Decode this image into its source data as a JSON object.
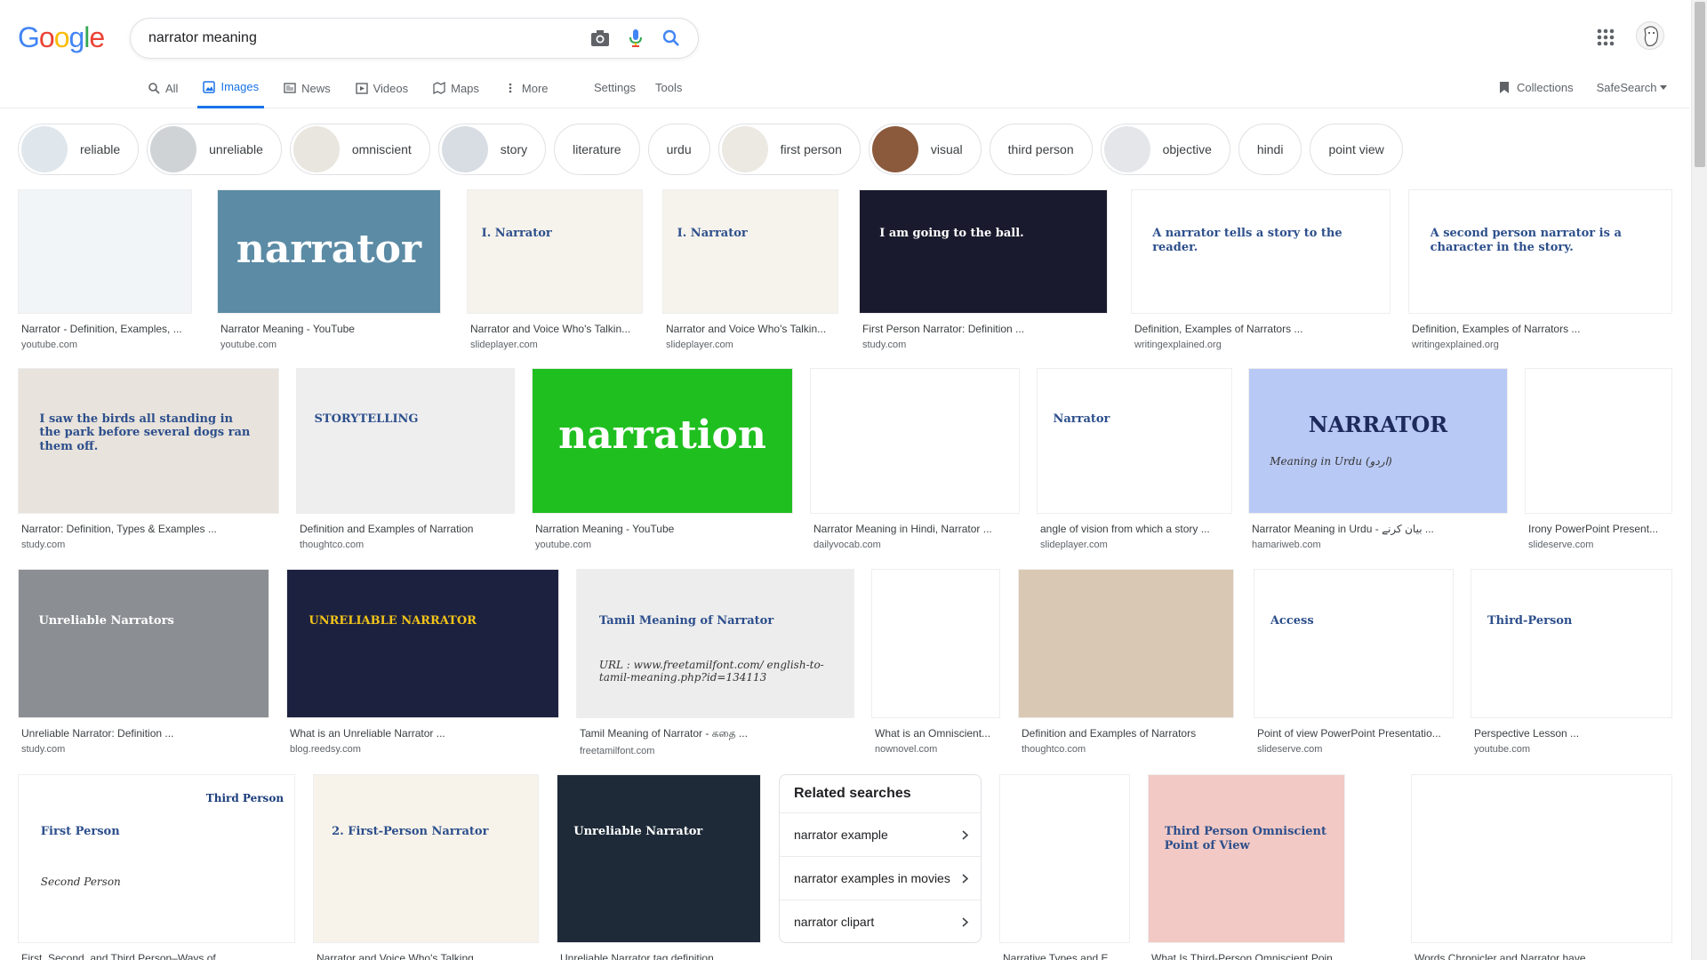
{
  "search": {
    "query": "narrator meaning"
  },
  "tabs": [
    {
      "label": "All"
    },
    {
      "label": "Images"
    },
    {
      "label": "News"
    },
    {
      "label": "Videos"
    },
    {
      "label": "Maps"
    },
    {
      "label": "More"
    }
  ],
  "tools": {
    "settings": "Settings",
    "tools": "Tools"
  },
  "right": {
    "collections": "Collections",
    "safesearch": "SafeSearch"
  },
  "chips": [
    {
      "label": "reliable",
      "thumb": true
    },
    {
      "label": "unreliable",
      "thumb": true
    },
    {
      "label": "omniscient",
      "thumb": true
    },
    {
      "label": "story",
      "thumb": true
    },
    {
      "label": "literature",
      "thumb": false
    },
    {
      "label": "urdu",
      "thumb": false
    },
    {
      "label": "first person",
      "thumb": true
    },
    {
      "label": "visual",
      "thumb": true
    },
    {
      "label": "third person",
      "thumb": false
    },
    {
      "label": "objective",
      "thumb": true
    },
    {
      "label": "hindi",
      "thumb": false
    },
    {
      "label": "point view",
      "thumb": false
    }
  ],
  "results": [
    {
      "caption": "Narrator - Definition, Examples, ...",
      "source": "youtube.com"
    },
    {
      "caption": "Narrator Meaning - YouTube",
      "source": "youtube.com",
      "img_text": "narrator"
    },
    {
      "caption": "Narrator and Voice Who's Talkin...",
      "source": "slideplayer.com",
      "img_text": "I. Narrator"
    },
    {
      "caption": "Narrator and Voice Who's Talkin...",
      "source": "slideplayer.com",
      "img_text": "I. Narrator"
    },
    {
      "caption": "First Person Narrator: Definition ...",
      "source": "study.com",
      "img_text": "I am going to the ball."
    },
    {
      "caption": "Definition, Examples of Narrators ...",
      "source": "writingexplained.org",
      "img_text": "A narrator tells a story to the reader."
    },
    {
      "caption": "Definition, Examples of Narrators ...",
      "source": "writingexplained.org",
      "img_text": "A second person narrator is a character in the story."
    },
    {
      "caption": "Narrator: Definition, Types & Examples ...",
      "source": "study.com",
      "img_text": "I saw the birds all standing in the park before several dogs ran them off."
    },
    {
      "caption": "Definition and Examples of Narration",
      "source": "thoughtco.com",
      "img_text": "STORYTELLING"
    },
    {
      "caption": "Narration Meaning - YouTube",
      "source": "youtube.com",
      "img_text": "narration"
    },
    {
      "caption": "Narrator Meaning in Hindi, Narrator ...",
      "source": "dailyvocab.com"
    },
    {
      "caption": "angle of vision from which a story ...",
      "source": "slideplayer.com",
      "img_text": "Narrator"
    },
    {
      "caption": "Narrator Meaning in Urdu - بیان کرنے ...",
      "source": "hamariweb.com",
      "img_text": "NARRATOR",
      "img_text2": "Meaning in Urdu (اردو)"
    },
    {
      "caption": "Irony PowerPoint Present...",
      "source": "slideserve.com"
    },
    {
      "caption": "Unreliable Narrator: Definition ...",
      "source": "study.com",
      "img_text": "Unreliable Narrators"
    },
    {
      "caption": "What is an Unreliable Narrator ...",
      "source": "blog.reedsy.com",
      "img_text": "UNRELIABLE NARRATOR"
    },
    {
      "caption": "Tamil Meaning of Narrator - கதை ...",
      "source": "freetamilfont.com",
      "img_text": "Tamil Meaning of Narrator",
      "img_text2": "URL : www.freetamilfont.com/ english-to-tamil-meaning.php?id=134113"
    },
    {
      "caption": "What is an Omniscient...",
      "source": "nownovel.com"
    },
    {
      "caption": "Definition and Examples of Narrators",
      "source": "thoughtco.com"
    },
    {
      "caption": "Point of view PowerPoint Presentatio...",
      "source": "slideserve.com",
      "img_text": "Access"
    },
    {
      "caption": "Perspective Lesson ...",
      "source": "youtube.com",
      "img_text": "Third-Person"
    },
    {
      "caption": "First, Second, and Third Person–Ways of ...",
      "source": "",
      "img_text": "First Person",
      "img_text2": "Second Person",
      "img_text3": "Third Person"
    },
    {
      "caption": "Narrator and Voice Who's Talking ...",
      "source": "",
      "img_text": "2. First-Person Narrator"
    },
    {
      "caption": "Unreliable Narrator tag definition ...",
      "source": "",
      "img_text": "Unreliable Narrator"
    },
    {
      "caption": "Narrative Types and E...",
      "source": ""
    },
    {
      "caption": "What Is Third-Person Omniscient Point ...",
      "source": "",
      "img_text": "Third Person Omniscient Point of View"
    },
    {
      "caption": "Words Chronicler and Narrator have ...",
      "source": ""
    }
  ],
  "related": {
    "title": "Related searches",
    "items": [
      {
        "label": "narrator example"
      },
      {
        "label": "narrator examples in movies"
      },
      {
        "label": "narrator clipart"
      }
    ]
  },
  "colors": {
    "accent": "#1a73e8"
  }
}
